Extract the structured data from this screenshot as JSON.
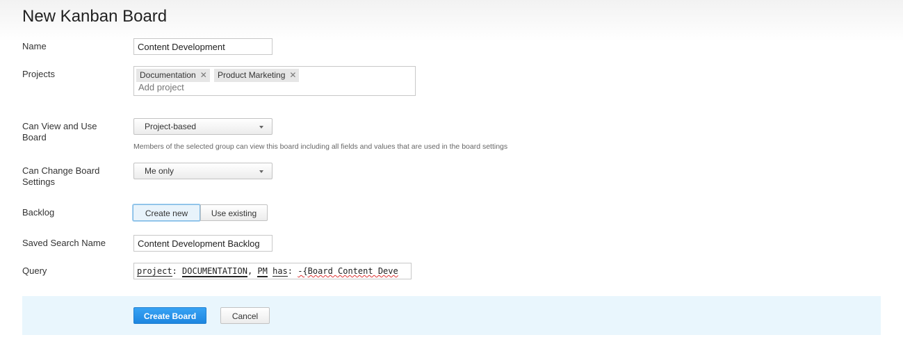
{
  "page": {
    "title": "New Kanban Board"
  },
  "form": {
    "name": {
      "label": "Name",
      "value": "Content Development"
    },
    "projects": {
      "label": "Projects",
      "tags": [
        {
          "label": "Documentation"
        },
        {
          "label": "Product Marketing"
        }
      ],
      "placeholder": "Add project"
    },
    "can_view": {
      "label": "Can View and Use Board",
      "value": "Project-based",
      "hint": "Members of the selected group can view this board including all fields and values that are used in the board settings"
    },
    "can_change": {
      "label": "Can Change Board Settings",
      "value": "Me only"
    },
    "backlog": {
      "label": "Backlog",
      "options": [
        "Create new",
        "Use existing"
      ],
      "selected": "Create new"
    },
    "saved_search": {
      "label": "Saved Search Name",
      "value": "Content Development Backlog"
    },
    "query": {
      "label": "Query",
      "parts": [
        "project",
        ": ",
        "DOCUMENTATION",
        ", ",
        "PM",
        " ",
        "has",
        ": ",
        "-{Board Content Deve"
      ]
    }
  },
  "footer": {
    "create_label": "Create Board",
    "cancel_label": "Cancel"
  },
  "icons": {
    "remove_tag": "close-icon",
    "dropdown": "chevron-down-icon"
  },
  "colors": {
    "primary": "#1d86e0",
    "footer_bg": "#e9f6fd",
    "active_border": "#7fb9e3"
  }
}
